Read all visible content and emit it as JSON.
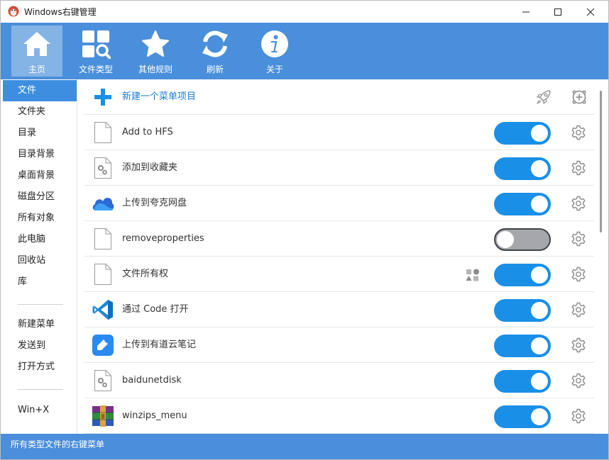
{
  "window": {
    "title": "Windows右键管理"
  },
  "toolbar": {
    "items": [
      {
        "label": "主页",
        "icon": "home-icon"
      },
      {
        "label": "文件类型",
        "icon": "file-types-icon"
      },
      {
        "label": "其他规则",
        "icon": "star-icon"
      },
      {
        "label": "刷新",
        "icon": "refresh-icon"
      },
      {
        "label": "关于",
        "icon": "info-icon"
      }
    ],
    "active": "主页"
  },
  "sidebar": {
    "items": [
      {
        "label": "文件"
      },
      {
        "label": "文件夹"
      },
      {
        "label": "目录"
      },
      {
        "label": "目录背景"
      },
      {
        "label": "桌面背景"
      },
      {
        "label": "磁盘分区"
      },
      {
        "label": "所有对象"
      },
      {
        "label": "此电脑"
      },
      {
        "label": "回收站"
      },
      {
        "label": "库"
      },
      {
        "label": "新建菜单"
      },
      {
        "label": "发送到"
      },
      {
        "label": "打开方式"
      },
      {
        "label": "Win+X"
      }
    ],
    "active": "文件"
  },
  "main": {
    "new_item_label": "新建一个菜单项目",
    "rows": [
      {
        "label": "Add to HFS",
        "icon": "blank-file-icon",
        "enabled": true
      },
      {
        "label": "添加到收藏夹",
        "icon": "settings-file-icon",
        "enabled": true
      },
      {
        "label": "上传到夸克网盘",
        "icon": "cloud-icon",
        "enabled": true
      },
      {
        "label": "removeproperties",
        "icon": "blank-file-icon",
        "enabled": false
      },
      {
        "label": "文件所有权",
        "icon": "blank-file-icon",
        "enabled": true,
        "extra_icon": "shapes-icon"
      },
      {
        "label": "通过 Code 打开",
        "icon": "vscode-icon",
        "enabled": true
      },
      {
        "label": "上传到有道云笔记",
        "icon": "note-icon",
        "enabled": true
      },
      {
        "label": "baidunetdisk",
        "icon": "settings-file-icon",
        "enabled": true
      },
      {
        "label": "winzips_menu",
        "icon": "archive-icon",
        "enabled": true
      }
    ]
  },
  "status": {
    "text": "所有类型文件的右键菜单"
  },
  "colors": {
    "accent": "#4a8fdb",
    "toggle_on": "#1a8fe8",
    "toggle_off": "#a5a7ad",
    "sidebar_active": "#3d8ee0",
    "link": "#1a7cd8"
  }
}
